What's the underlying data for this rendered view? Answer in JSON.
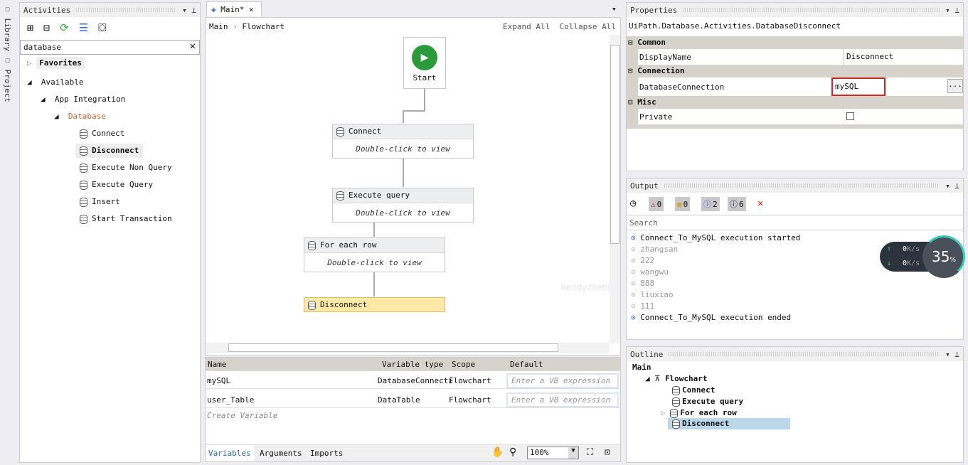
{
  "side_tabs": [
    "Library",
    "Project"
  ],
  "activities": {
    "title": "Activities",
    "search": "database",
    "favorites": "Favorites",
    "available": "Available",
    "app_integration": "App Integration",
    "database": "Database",
    "items": [
      "Connect",
      "Disconnect",
      "Execute Non Query",
      "Execute Query",
      "Insert",
      "Start Transaction"
    ],
    "selected": "Disconnect"
  },
  "designer": {
    "tab": "Main*",
    "breadcrumb": [
      "Main",
      "Flowchart"
    ],
    "expand_all": "Expand All",
    "collapse_all": "Collapse All",
    "start": "Start",
    "nodes": [
      {
        "title": "Connect",
        "body": "Double-click to view"
      },
      {
        "title": "Execute query",
        "body": "Double-click to view"
      },
      {
        "title": "For each row",
        "body": "Double-click to view"
      },
      {
        "title": "Disconnect"
      }
    ],
    "watermark": "wendyzheng"
  },
  "variables": {
    "columns": [
      "Name",
      "Variable type",
      "Scope",
      "Default"
    ],
    "rows": [
      [
        "mySQL",
        "DatabaseConnecti",
        "Flowchart"
      ],
      [
        "user_Table",
        "DataTable",
        "Flowchart"
      ]
    ],
    "default_placeholder": "Enter a VB expression",
    "create": "Create Variable",
    "tabs": [
      "Variables",
      "Arguments",
      "Imports"
    ],
    "zoom": "100%"
  },
  "properties": {
    "title": "Properties",
    "type": "UiPath.Database.Activities.DatabaseDisconnect",
    "sections": [
      {
        "name": "Common",
        "props": [
          [
            "DisplayName",
            "Disconnect"
          ]
        ]
      },
      {
        "name": "Connection",
        "props": [
          [
            "DatabaseConnection",
            "mySQL"
          ]
        ]
      },
      {
        "name": "Misc",
        "props": [
          [
            "Private",
            ""
          ]
        ]
      }
    ],
    "highlight_color": "#e02020"
  },
  "output": {
    "title": "Output",
    "counts": {
      "error": "0",
      "warning": "0",
      "info": "2",
      "trace": "6"
    },
    "search_placeholder": "Search",
    "lines": [
      {
        "text": "Connect_To_MySQL execution started",
        "level": "info"
      },
      {
        "text": "zhangsan",
        "level": "trace"
      },
      {
        "text": "222",
        "level": "trace"
      },
      {
        "text": "wangwu",
        "level": "trace"
      },
      {
        "text": "888",
        "level": "trace"
      },
      {
        "text": "liuxiao",
        "level": "trace"
      },
      {
        "text": "111",
        "level": "trace"
      },
      {
        "text": "Connect_To_MySQL execution ended",
        "level": "info"
      }
    ]
  },
  "net_widget": {
    "up": "0",
    "down": "0",
    "unit": "K/s",
    "percent": "35",
    "pct_sign": "%"
  },
  "outline": {
    "title": "Outline",
    "items": [
      "Main",
      "Flowchart",
      "Connect",
      "Execute query",
      "For each row",
      "Disconnect"
    ],
    "selected": "Disconnect"
  }
}
